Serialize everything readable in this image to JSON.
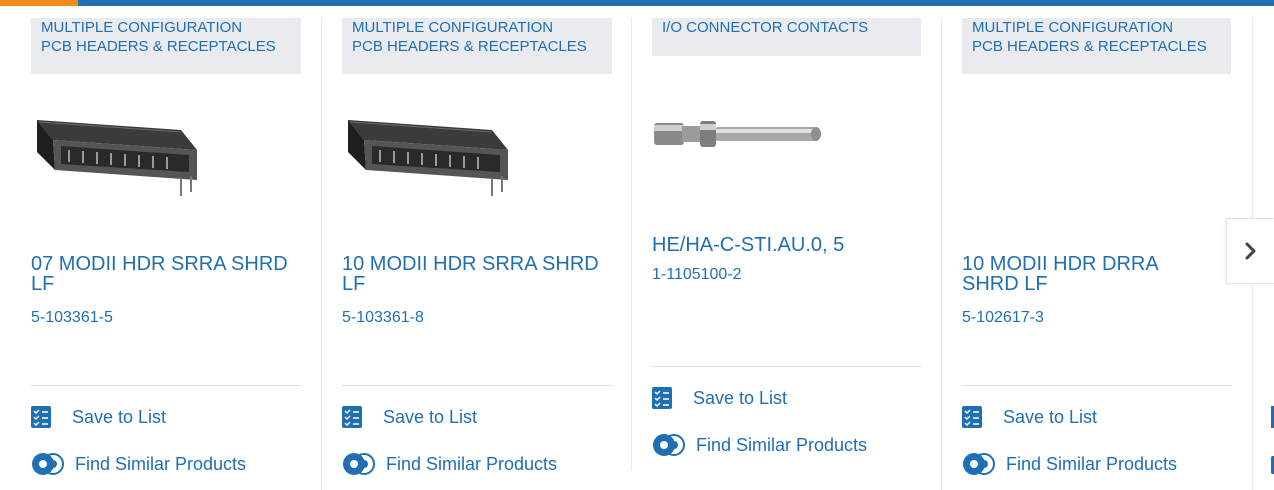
{
  "products": [
    {
      "category": [
        "MULTIPLE CONFIGURATION",
        "PCB HEADERS & RECEPTACLES"
      ],
      "title": "07 MODII HDR SRRA SHRD LF",
      "title_lines": [
        "07 MODII HDR SRRA SHRD",
        "LF"
      ],
      "part_number": "5-103361-5",
      "image": "pcb-header-connector-image",
      "save_label": "Save to List",
      "similar_label": "Find Similar Products"
    },
    {
      "category": [
        "MULTIPLE CONFIGURATION",
        "PCB HEADERS & RECEPTACLES"
      ],
      "title": "10 MODII HDR SRRA SHRD LF",
      "title_lines": [
        "10 MODII HDR SRRA SHRD",
        "LF"
      ],
      "part_number": "5-103361-8",
      "image": "pcb-header-connector-image",
      "save_label": "Save to List",
      "similar_label": "Find Similar Products"
    },
    {
      "category": [
        "I/O CONNECTOR CONTACTS"
      ],
      "title": "HE/HA-C-STI.AU.0, 5",
      "title_lines": [
        "HE/HA-C-STI.AU.0, 5"
      ],
      "part_number": "1-1105100-2",
      "image": "pin-contact-image",
      "save_label": "Save to List",
      "similar_label": "Find Similar Products"
    },
    {
      "category": [
        "MULTIPLE CONFIGURATION",
        "PCB HEADERS & RECEPTACLES"
      ],
      "title": "10 MODII HDR DRRA SHRD LF",
      "title_lines": [
        "10 MODII HDR DRRA",
        "SHRD LF"
      ],
      "part_number": "5-102617-3",
      "image": "",
      "save_label": "Save to List",
      "similar_label": "Find Similar Products"
    }
  ],
  "navigation": {
    "next_icon": "chevron-right-icon"
  },
  "colors": {
    "link": "#1f6fb2",
    "category_bg": "#e9ebee",
    "topbar": "#1f6fb2",
    "topbar_accent": "#f28c1e"
  }
}
